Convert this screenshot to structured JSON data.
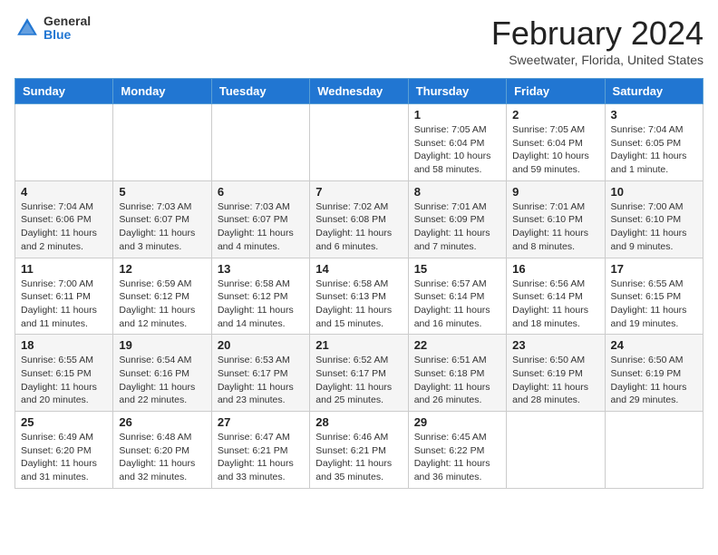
{
  "header": {
    "logo_general": "General",
    "logo_blue": "Blue",
    "month_title": "February 2024",
    "location": "Sweetwater, Florida, United States"
  },
  "days_of_week": [
    "Sunday",
    "Monday",
    "Tuesday",
    "Wednesday",
    "Thursday",
    "Friday",
    "Saturday"
  ],
  "weeks": [
    [
      {
        "day": "",
        "info": ""
      },
      {
        "day": "",
        "info": ""
      },
      {
        "day": "",
        "info": ""
      },
      {
        "day": "",
        "info": ""
      },
      {
        "day": "1",
        "info": "Sunrise: 7:05 AM\nSunset: 6:04 PM\nDaylight: 10 hours and 58 minutes."
      },
      {
        "day": "2",
        "info": "Sunrise: 7:05 AM\nSunset: 6:04 PM\nDaylight: 10 hours and 59 minutes."
      },
      {
        "day": "3",
        "info": "Sunrise: 7:04 AM\nSunset: 6:05 PM\nDaylight: 11 hours and 1 minute."
      }
    ],
    [
      {
        "day": "4",
        "info": "Sunrise: 7:04 AM\nSunset: 6:06 PM\nDaylight: 11 hours and 2 minutes."
      },
      {
        "day": "5",
        "info": "Sunrise: 7:03 AM\nSunset: 6:07 PM\nDaylight: 11 hours and 3 minutes."
      },
      {
        "day": "6",
        "info": "Sunrise: 7:03 AM\nSunset: 6:07 PM\nDaylight: 11 hours and 4 minutes."
      },
      {
        "day": "7",
        "info": "Sunrise: 7:02 AM\nSunset: 6:08 PM\nDaylight: 11 hours and 6 minutes."
      },
      {
        "day": "8",
        "info": "Sunrise: 7:01 AM\nSunset: 6:09 PM\nDaylight: 11 hours and 7 minutes."
      },
      {
        "day": "9",
        "info": "Sunrise: 7:01 AM\nSunset: 6:10 PM\nDaylight: 11 hours and 8 minutes."
      },
      {
        "day": "10",
        "info": "Sunrise: 7:00 AM\nSunset: 6:10 PM\nDaylight: 11 hours and 9 minutes."
      }
    ],
    [
      {
        "day": "11",
        "info": "Sunrise: 7:00 AM\nSunset: 6:11 PM\nDaylight: 11 hours and 11 minutes."
      },
      {
        "day": "12",
        "info": "Sunrise: 6:59 AM\nSunset: 6:12 PM\nDaylight: 11 hours and 12 minutes."
      },
      {
        "day": "13",
        "info": "Sunrise: 6:58 AM\nSunset: 6:12 PM\nDaylight: 11 hours and 14 minutes."
      },
      {
        "day": "14",
        "info": "Sunrise: 6:58 AM\nSunset: 6:13 PM\nDaylight: 11 hours and 15 minutes."
      },
      {
        "day": "15",
        "info": "Sunrise: 6:57 AM\nSunset: 6:14 PM\nDaylight: 11 hours and 16 minutes."
      },
      {
        "day": "16",
        "info": "Sunrise: 6:56 AM\nSunset: 6:14 PM\nDaylight: 11 hours and 18 minutes."
      },
      {
        "day": "17",
        "info": "Sunrise: 6:55 AM\nSunset: 6:15 PM\nDaylight: 11 hours and 19 minutes."
      }
    ],
    [
      {
        "day": "18",
        "info": "Sunrise: 6:55 AM\nSunset: 6:15 PM\nDaylight: 11 hours and 20 minutes."
      },
      {
        "day": "19",
        "info": "Sunrise: 6:54 AM\nSunset: 6:16 PM\nDaylight: 11 hours and 22 minutes."
      },
      {
        "day": "20",
        "info": "Sunrise: 6:53 AM\nSunset: 6:17 PM\nDaylight: 11 hours and 23 minutes."
      },
      {
        "day": "21",
        "info": "Sunrise: 6:52 AM\nSunset: 6:17 PM\nDaylight: 11 hours and 25 minutes."
      },
      {
        "day": "22",
        "info": "Sunrise: 6:51 AM\nSunset: 6:18 PM\nDaylight: 11 hours and 26 minutes."
      },
      {
        "day": "23",
        "info": "Sunrise: 6:50 AM\nSunset: 6:19 PM\nDaylight: 11 hours and 28 minutes."
      },
      {
        "day": "24",
        "info": "Sunrise: 6:50 AM\nSunset: 6:19 PM\nDaylight: 11 hours and 29 minutes."
      }
    ],
    [
      {
        "day": "25",
        "info": "Sunrise: 6:49 AM\nSunset: 6:20 PM\nDaylight: 11 hours and 31 minutes."
      },
      {
        "day": "26",
        "info": "Sunrise: 6:48 AM\nSunset: 6:20 PM\nDaylight: 11 hours and 32 minutes."
      },
      {
        "day": "27",
        "info": "Sunrise: 6:47 AM\nSunset: 6:21 PM\nDaylight: 11 hours and 33 minutes."
      },
      {
        "day": "28",
        "info": "Sunrise: 6:46 AM\nSunset: 6:21 PM\nDaylight: 11 hours and 35 minutes."
      },
      {
        "day": "29",
        "info": "Sunrise: 6:45 AM\nSunset: 6:22 PM\nDaylight: 11 hours and 36 minutes."
      },
      {
        "day": "",
        "info": ""
      },
      {
        "day": "",
        "info": ""
      }
    ]
  ]
}
